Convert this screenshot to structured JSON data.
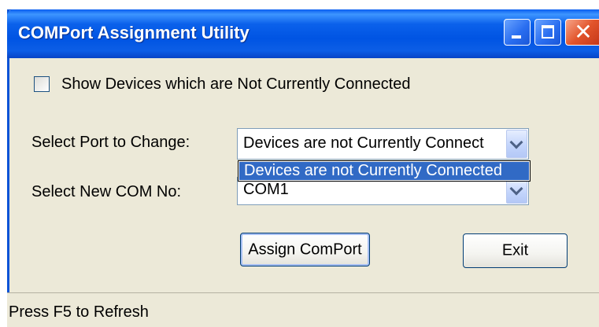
{
  "window": {
    "title": "COMPort Assignment Utility"
  },
  "options": {
    "show_disconnected_label": "Show Devices which are Not Currently Connected",
    "show_disconnected_checked": false
  },
  "port_select": {
    "label": "Select Port to Change:",
    "selected_value": "Devices are not Currently Connect",
    "open_list_items": [
      "Devices are not Currently Connected"
    ]
  },
  "com_select": {
    "label": "Select New COM No:",
    "selected_value": "COM1"
  },
  "buttons": {
    "assign": "Assign ComPort",
    "exit": "Exit"
  },
  "status": {
    "text": "Press F5 to Refresh"
  },
  "icons": {
    "minimize": "minimize-icon",
    "maximize": "maximize-icon",
    "close": "close-icon",
    "dropdown": "chevron-down-icon"
  },
  "colors": {
    "titlebar": "#0054e3",
    "window_bg": "#ece9d8",
    "selection": "#316ac5",
    "close_button": "#e2542b"
  }
}
